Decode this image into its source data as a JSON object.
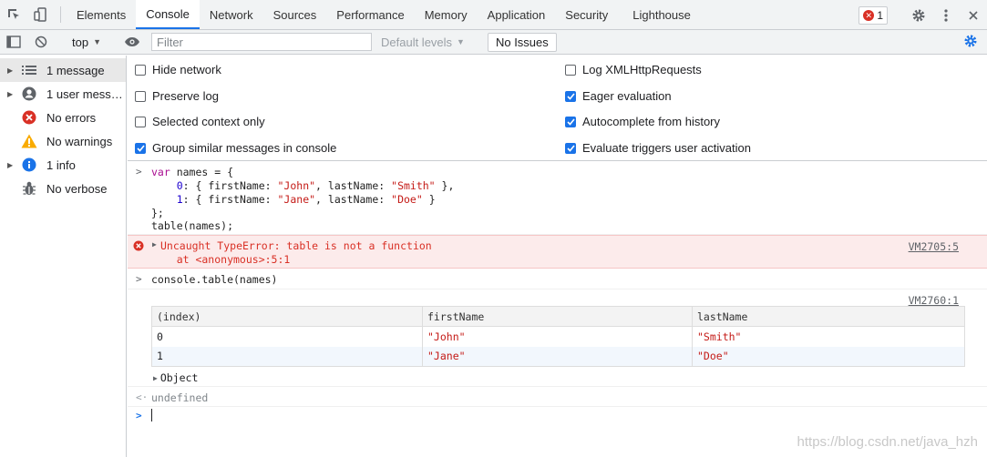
{
  "tabs": [
    "Elements",
    "Console",
    "Network",
    "Sources",
    "Performance",
    "Memory",
    "Application",
    "Security",
    "Lighthouse"
  ],
  "active_tab": "Console",
  "error_count": "1",
  "toolbar": {
    "context": "top",
    "filter_placeholder": "Filter",
    "levels": "Default levels",
    "no_issues": "No Issues"
  },
  "sidebar": {
    "items": [
      {
        "label": "1 message",
        "icon": "list-icon"
      },
      {
        "label": "1 user mess…",
        "icon": "user-icon"
      },
      {
        "label": "No errors",
        "icon": "error-icon"
      },
      {
        "label": "No warnings",
        "icon": "warning-icon"
      },
      {
        "label": "1 info",
        "icon": "info-icon"
      },
      {
        "label": "No verbose",
        "icon": "bug-icon"
      }
    ]
  },
  "settings": {
    "hide_network": "Hide network",
    "preserve_log": "Preserve log",
    "selected_context": "Selected context only",
    "group_similar": "Group similar messages in console",
    "log_xhr": "Log XMLHttpRequests",
    "eager_eval": "Eager evaluation",
    "autocomplete": "Autocomplete from history",
    "evaluate_triggers": "Evaluate triggers user activation"
  },
  "console": {
    "input1": {
      "l1_kw": "var",
      "l1_rest": " names = {",
      "l2_key": "0",
      "l2_a": ": { firstName: ",
      "l2_s1": "\"John\"",
      "l2_b": ", lastName: ",
      "l2_s2": "\"Smith\"",
      "l2_c": " },",
      "l3_key": "1",
      "l3_a": ": { firstName: ",
      "l3_s1": "\"Jane\"",
      "l3_b": ", lastName: ",
      "l3_s2": "\"Doe\"",
      "l3_c": " }",
      "l4": "};",
      "l5": "table(names);"
    },
    "error": {
      "message": "Uncaught TypeError: table is not a function",
      "stack": "    at <anonymous>:5:1",
      "source": "VM2705:5"
    },
    "input2": "console.table(names)",
    "table_source": "VM2760:1",
    "table": {
      "headers": [
        "(index)",
        "firstName",
        "lastName"
      ],
      "rows": [
        [
          "0",
          "\"John\"",
          "\"Smith\""
        ],
        [
          "1",
          "\"Jane\"",
          "\"Doe\""
        ]
      ]
    },
    "object_label": "Object",
    "result": "undefined"
  },
  "watermark": "https://blog.csdn.net/java_hzh"
}
